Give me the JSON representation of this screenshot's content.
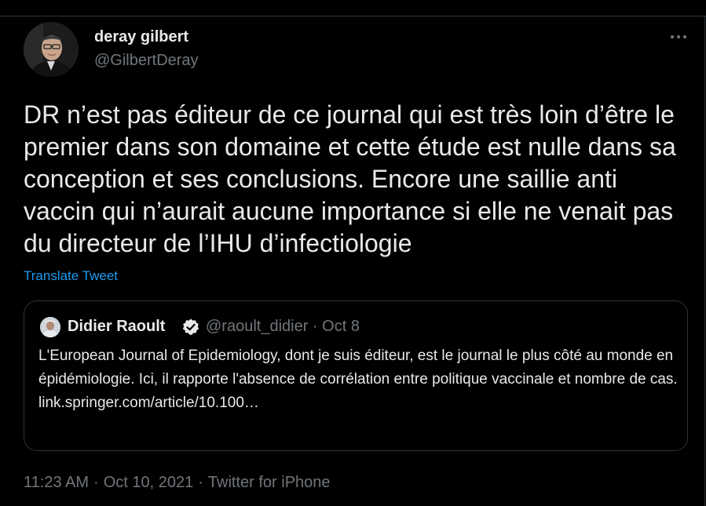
{
  "author": {
    "display_name": "deray gilbert",
    "handle": "@GilbertDeray"
  },
  "more_icon": "more-horizontal-icon",
  "tweet": {
    "text": "DR n’est pas éditeur de ce journal qui est très loin d’être le premier dans son domaine et cette étude est nulle dans sa conception et ses conclusions. Encore une saillie anti vaccin qui n’aurait aucune importance si elle ne venait pas du directeur de l’IHU d’infectiologie",
    "translate_label": "Translate Tweet"
  },
  "quote": {
    "display_name": "Didier Raoult",
    "verified_icon": "verified-badge-icon",
    "handle_date": "@raoult_didier · Oct 8",
    "text": "L'European Journal of Epidemiology, dont je suis éditeur, est le journal le plus côté au monde en épidémiologie. Ici, il rapporte l'absence de corrélation entre politique vaccinale et nombre de cas.",
    "link": "link.springer.com/article/10.100…"
  },
  "meta": {
    "time": "11:23 AM",
    "separator": "·",
    "date": "Oct 10, 2021",
    "source": "Twitter for iPhone"
  },
  "colors": {
    "background": "#000000",
    "text": "#e7e9ea",
    "secondary": "#71767b",
    "link": "#1d9bf0",
    "border": "#2f3336"
  }
}
